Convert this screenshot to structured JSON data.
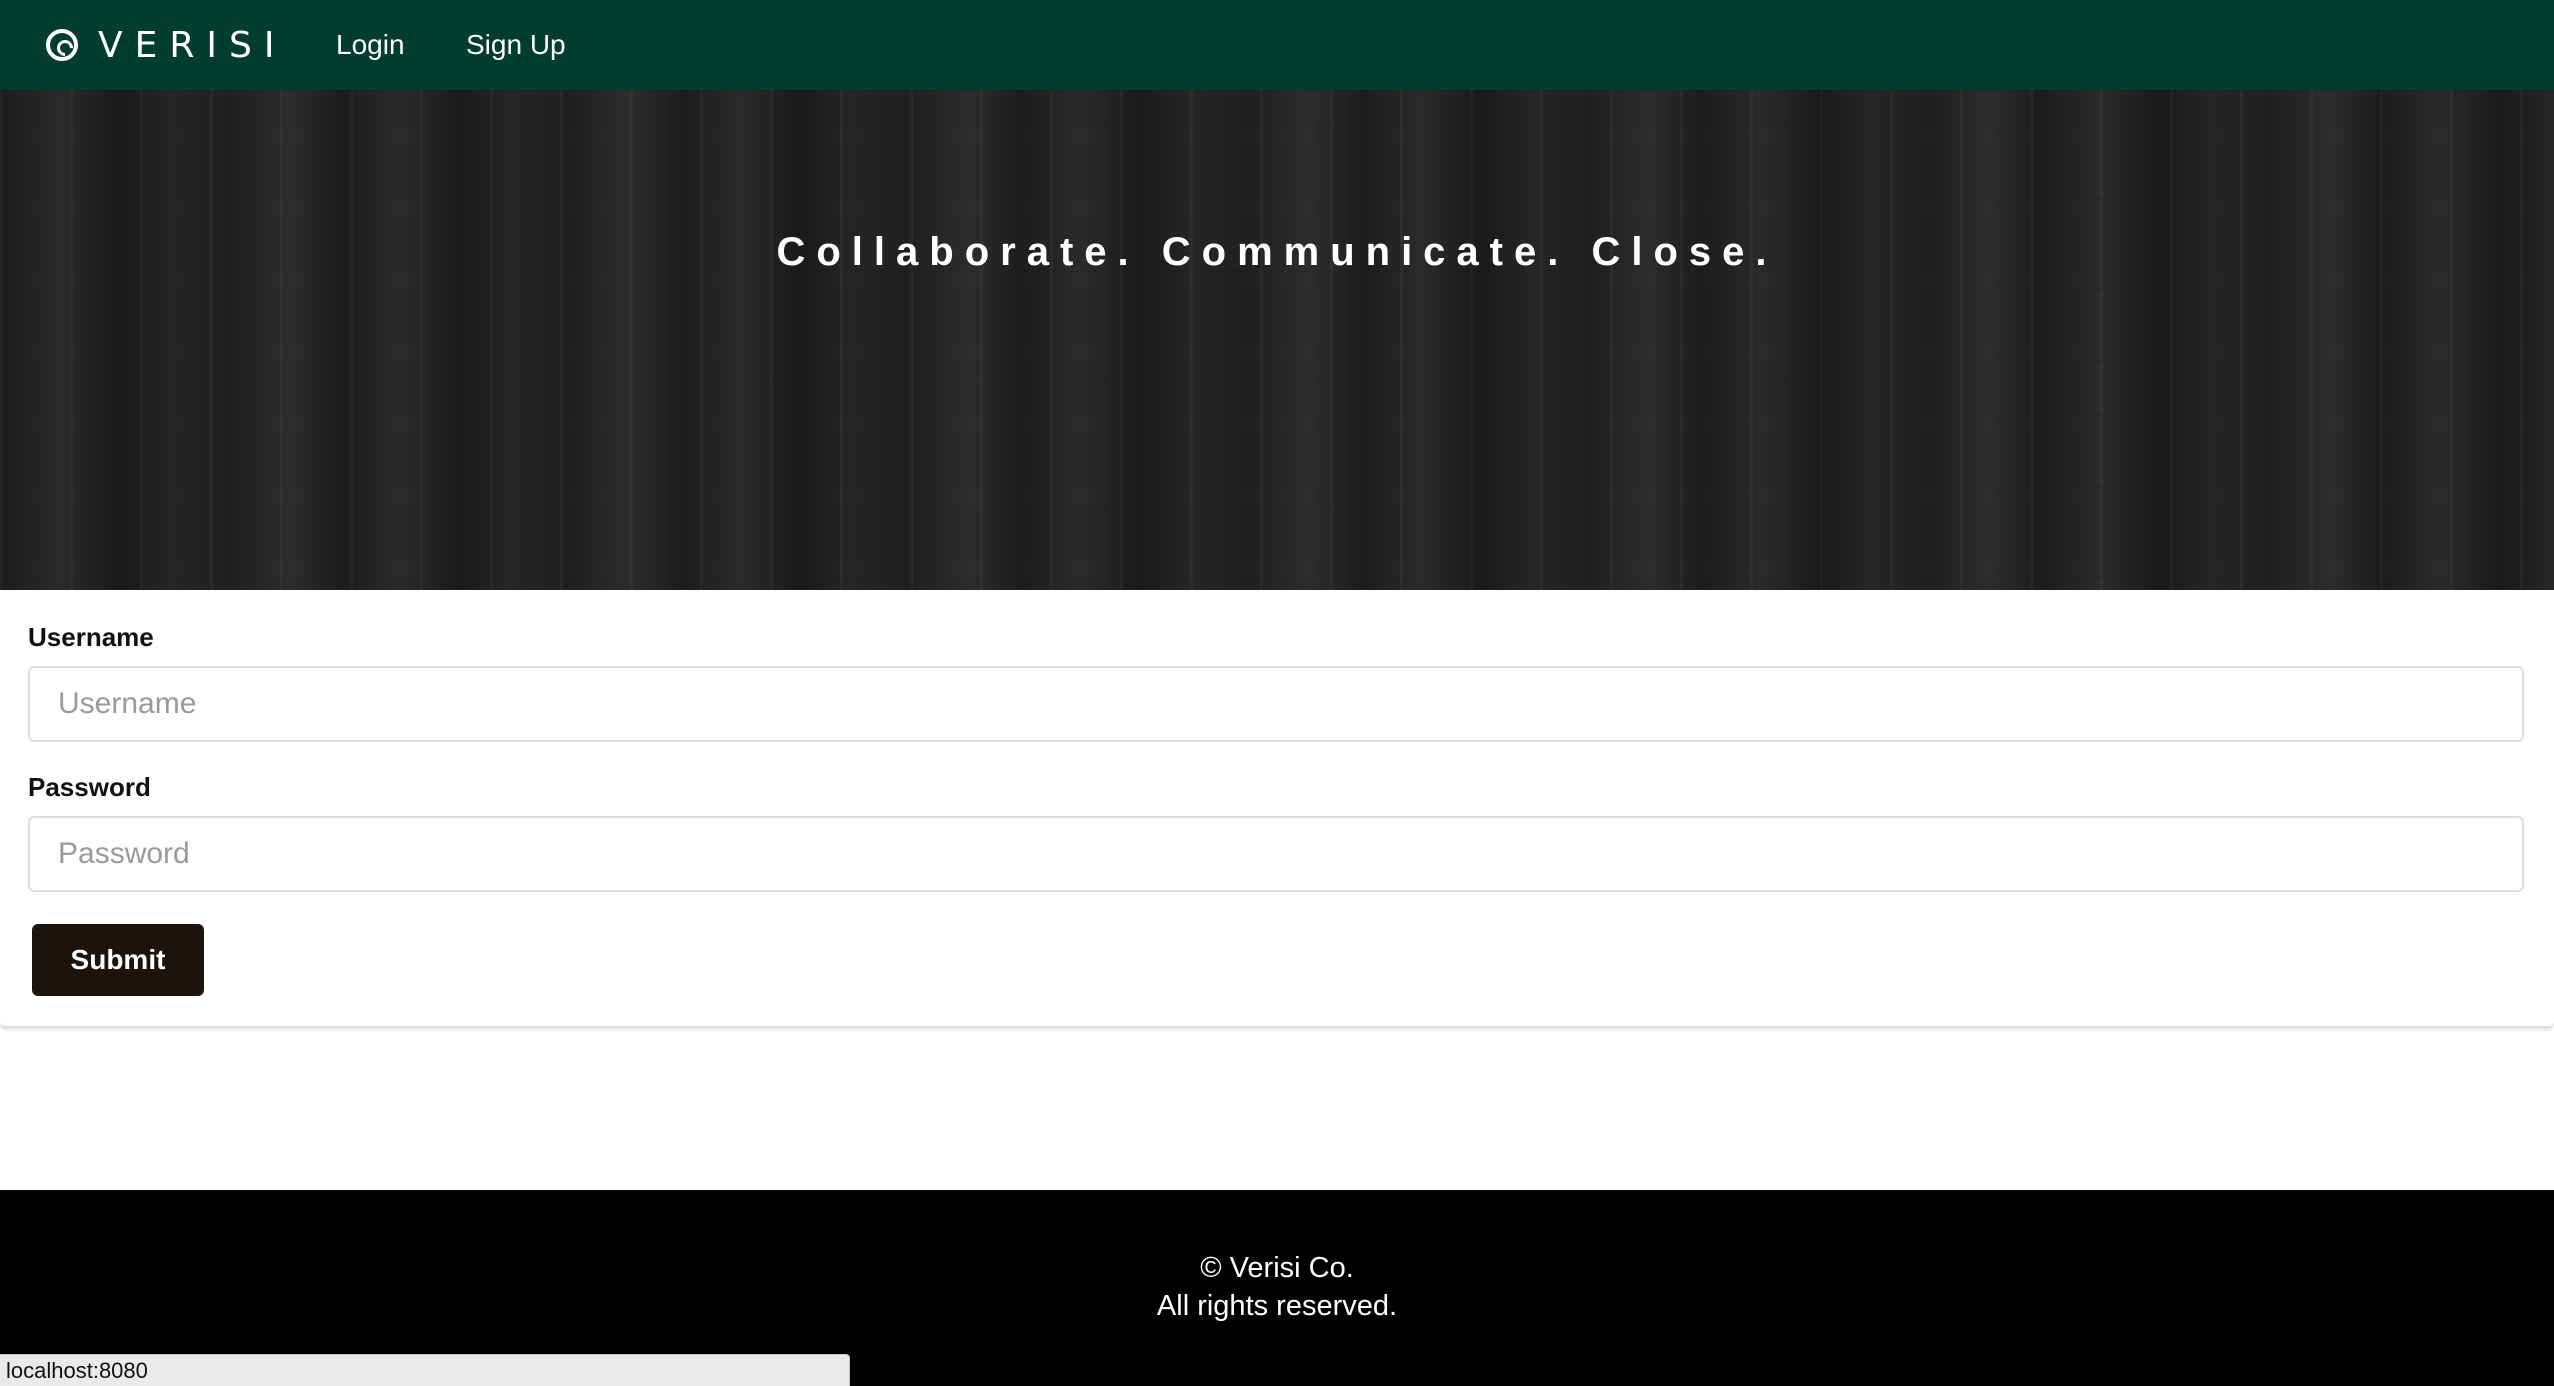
{
  "navbar": {
    "brand": "VERISI",
    "brand_icon": "compass-icon",
    "links": [
      {
        "label": "Login"
      },
      {
        "label": "Sign Up"
      }
    ],
    "background": "#013d2f"
  },
  "hero": {
    "tagline": "Collaborate. Communicate. Close."
  },
  "form": {
    "username_label": "Username",
    "username_placeholder": "Username",
    "username_value": "",
    "password_label": "Password",
    "password_placeholder": "Password",
    "password_value": "",
    "submit_label": "Submit",
    "submit_color": "#1e120c"
  },
  "footer": {
    "line1": "© Verisi Co.",
    "line2": "All rights reserved."
  },
  "statusbar": {
    "url": "localhost:8080"
  }
}
